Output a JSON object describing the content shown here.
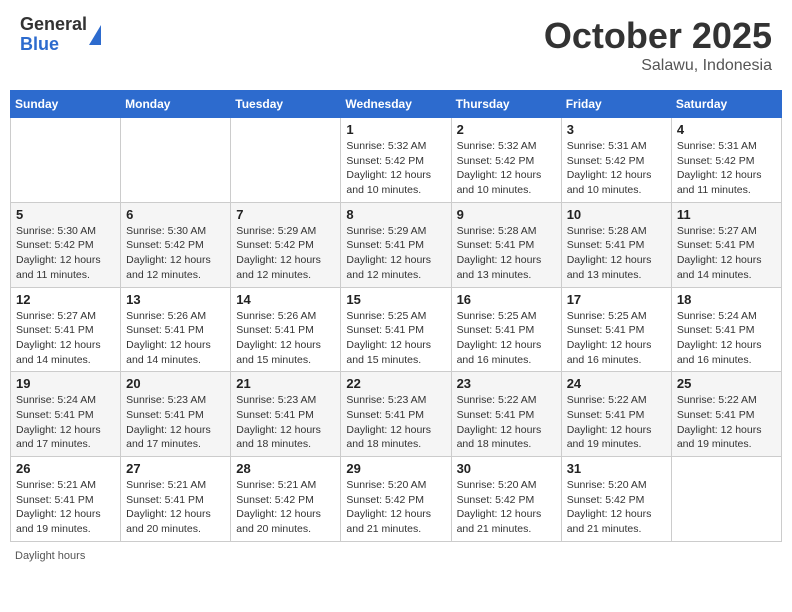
{
  "header": {
    "logo_general": "General",
    "logo_blue": "Blue",
    "month_title": "October 2025",
    "location": "Salawu, Indonesia"
  },
  "footer": {
    "daylight_label": "Daylight hours"
  },
  "weekdays": [
    "Sunday",
    "Monday",
    "Tuesday",
    "Wednesday",
    "Thursday",
    "Friday",
    "Saturday"
  ],
  "weeks": [
    [
      {
        "day": "",
        "sunrise": "",
        "sunset": "",
        "daylight": ""
      },
      {
        "day": "",
        "sunrise": "",
        "sunset": "",
        "daylight": ""
      },
      {
        "day": "",
        "sunrise": "",
        "sunset": "",
        "daylight": ""
      },
      {
        "day": "1",
        "sunrise": "Sunrise: 5:32 AM",
        "sunset": "Sunset: 5:42 PM",
        "daylight": "Daylight: 12 hours and 10 minutes."
      },
      {
        "day": "2",
        "sunrise": "Sunrise: 5:32 AM",
        "sunset": "Sunset: 5:42 PM",
        "daylight": "Daylight: 12 hours and 10 minutes."
      },
      {
        "day": "3",
        "sunrise": "Sunrise: 5:31 AM",
        "sunset": "Sunset: 5:42 PM",
        "daylight": "Daylight: 12 hours and 10 minutes."
      },
      {
        "day": "4",
        "sunrise": "Sunrise: 5:31 AM",
        "sunset": "Sunset: 5:42 PM",
        "daylight": "Daylight: 12 hours and 11 minutes."
      }
    ],
    [
      {
        "day": "5",
        "sunrise": "Sunrise: 5:30 AM",
        "sunset": "Sunset: 5:42 PM",
        "daylight": "Daylight: 12 hours and 11 minutes."
      },
      {
        "day": "6",
        "sunrise": "Sunrise: 5:30 AM",
        "sunset": "Sunset: 5:42 PM",
        "daylight": "Daylight: 12 hours and 12 minutes."
      },
      {
        "day": "7",
        "sunrise": "Sunrise: 5:29 AM",
        "sunset": "Sunset: 5:42 PM",
        "daylight": "Daylight: 12 hours and 12 minutes."
      },
      {
        "day": "8",
        "sunrise": "Sunrise: 5:29 AM",
        "sunset": "Sunset: 5:41 PM",
        "daylight": "Daylight: 12 hours and 12 minutes."
      },
      {
        "day": "9",
        "sunrise": "Sunrise: 5:28 AM",
        "sunset": "Sunset: 5:41 PM",
        "daylight": "Daylight: 12 hours and 13 minutes."
      },
      {
        "day": "10",
        "sunrise": "Sunrise: 5:28 AM",
        "sunset": "Sunset: 5:41 PM",
        "daylight": "Daylight: 12 hours and 13 minutes."
      },
      {
        "day": "11",
        "sunrise": "Sunrise: 5:27 AM",
        "sunset": "Sunset: 5:41 PM",
        "daylight": "Daylight: 12 hours and 14 minutes."
      }
    ],
    [
      {
        "day": "12",
        "sunrise": "Sunrise: 5:27 AM",
        "sunset": "Sunset: 5:41 PM",
        "daylight": "Daylight: 12 hours and 14 minutes."
      },
      {
        "day": "13",
        "sunrise": "Sunrise: 5:26 AM",
        "sunset": "Sunset: 5:41 PM",
        "daylight": "Daylight: 12 hours and 14 minutes."
      },
      {
        "day": "14",
        "sunrise": "Sunrise: 5:26 AM",
        "sunset": "Sunset: 5:41 PM",
        "daylight": "Daylight: 12 hours and 15 minutes."
      },
      {
        "day": "15",
        "sunrise": "Sunrise: 5:25 AM",
        "sunset": "Sunset: 5:41 PM",
        "daylight": "Daylight: 12 hours and 15 minutes."
      },
      {
        "day": "16",
        "sunrise": "Sunrise: 5:25 AM",
        "sunset": "Sunset: 5:41 PM",
        "daylight": "Daylight: 12 hours and 16 minutes."
      },
      {
        "day": "17",
        "sunrise": "Sunrise: 5:25 AM",
        "sunset": "Sunset: 5:41 PM",
        "daylight": "Daylight: 12 hours and 16 minutes."
      },
      {
        "day": "18",
        "sunrise": "Sunrise: 5:24 AM",
        "sunset": "Sunset: 5:41 PM",
        "daylight": "Daylight: 12 hours and 16 minutes."
      }
    ],
    [
      {
        "day": "19",
        "sunrise": "Sunrise: 5:24 AM",
        "sunset": "Sunset: 5:41 PM",
        "daylight": "Daylight: 12 hours and 17 minutes."
      },
      {
        "day": "20",
        "sunrise": "Sunrise: 5:23 AM",
        "sunset": "Sunset: 5:41 PM",
        "daylight": "Daylight: 12 hours and 17 minutes."
      },
      {
        "day": "21",
        "sunrise": "Sunrise: 5:23 AM",
        "sunset": "Sunset: 5:41 PM",
        "daylight": "Daylight: 12 hours and 18 minutes."
      },
      {
        "day": "22",
        "sunrise": "Sunrise: 5:23 AM",
        "sunset": "Sunset: 5:41 PM",
        "daylight": "Daylight: 12 hours and 18 minutes."
      },
      {
        "day": "23",
        "sunrise": "Sunrise: 5:22 AM",
        "sunset": "Sunset: 5:41 PM",
        "daylight": "Daylight: 12 hours and 18 minutes."
      },
      {
        "day": "24",
        "sunrise": "Sunrise: 5:22 AM",
        "sunset": "Sunset: 5:41 PM",
        "daylight": "Daylight: 12 hours and 19 minutes."
      },
      {
        "day": "25",
        "sunrise": "Sunrise: 5:22 AM",
        "sunset": "Sunset: 5:41 PM",
        "daylight": "Daylight: 12 hours and 19 minutes."
      }
    ],
    [
      {
        "day": "26",
        "sunrise": "Sunrise: 5:21 AM",
        "sunset": "Sunset: 5:41 PM",
        "daylight": "Daylight: 12 hours and 19 minutes."
      },
      {
        "day": "27",
        "sunrise": "Sunrise: 5:21 AM",
        "sunset": "Sunset: 5:41 PM",
        "daylight": "Daylight: 12 hours and 20 minutes."
      },
      {
        "day": "28",
        "sunrise": "Sunrise: 5:21 AM",
        "sunset": "Sunset: 5:42 PM",
        "daylight": "Daylight: 12 hours and 20 minutes."
      },
      {
        "day": "29",
        "sunrise": "Sunrise: 5:20 AM",
        "sunset": "Sunset: 5:42 PM",
        "daylight": "Daylight: 12 hours and 21 minutes."
      },
      {
        "day": "30",
        "sunrise": "Sunrise: 5:20 AM",
        "sunset": "Sunset: 5:42 PM",
        "daylight": "Daylight: 12 hours and 21 minutes."
      },
      {
        "day": "31",
        "sunrise": "Sunrise: 5:20 AM",
        "sunset": "Sunset: 5:42 PM",
        "daylight": "Daylight: 12 hours and 21 minutes."
      },
      {
        "day": "",
        "sunrise": "",
        "sunset": "",
        "daylight": ""
      }
    ]
  ]
}
